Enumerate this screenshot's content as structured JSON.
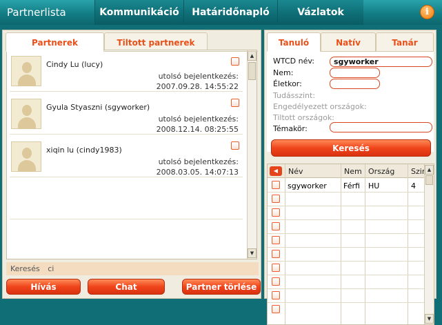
{
  "app": {
    "title": "Partnerlista"
  },
  "nav": {
    "tabs": [
      {
        "label": "Kommunikáció"
      },
      {
        "label": "Határidőnapló"
      },
      {
        "label": "Vázlatok"
      }
    ],
    "info_label": "i"
  },
  "left": {
    "tabs": [
      {
        "label": "Partnerek",
        "active": true
      },
      {
        "label": "Tiltott partnerek",
        "active": false
      }
    ],
    "partners": [
      {
        "name": "Cindy Lu (lucy)",
        "last_login_label": "utolsó bejelentkezés:",
        "last_login": "2007.09.28. 14:55:22"
      },
      {
        "name": "Gyula Styaszni (sgyworker)",
        "last_login_label": "utolsó bejelentkezés:",
        "last_login": "2008.12.14. 08:25:55"
      },
      {
        "name": "xiqin lu (cindy1983)",
        "last_login_label": "utolsó bejelentkezés:",
        "last_login": "2008.03.05. 14:07:13"
      }
    ],
    "search_label": "Keresés",
    "search_value": "ci",
    "buttons": {
      "call": "Hívás",
      "chat": "Chat",
      "delete": "Partner törlése"
    }
  },
  "right": {
    "tabs": [
      {
        "label": "Tanuló",
        "active": true
      },
      {
        "label": "Natív",
        "active": false
      },
      {
        "label": "Tanár",
        "active": false
      }
    ],
    "form": {
      "wtcd_label": "WTCD név:",
      "wtcd_value": "sgyworker",
      "gender_label": "Nem:",
      "gender_value": "",
      "age_label": "Életkor:",
      "age_value": "",
      "level_label": "Tudásszint:",
      "allowed_label": "Engedélyezett országok:",
      "banned_label": "Tiltott országok:",
      "topic_label": "Témakör:",
      "topic_value": ""
    },
    "search_button": "Keresés",
    "results": {
      "back_icon": "◀",
      "columns": [
        "Név",
        "Nem",
        "Ország",
        "Szint"
      ],
      "rows": [
        {
          "name": "sgyworker",
          "gender": "Férfi",
          "country": "HU",
          "level": "4"
        }
      ]
    }
  },
  "colors": {
    "accent": "#f0451b",
    "brand": "#137d85"
  }
}
